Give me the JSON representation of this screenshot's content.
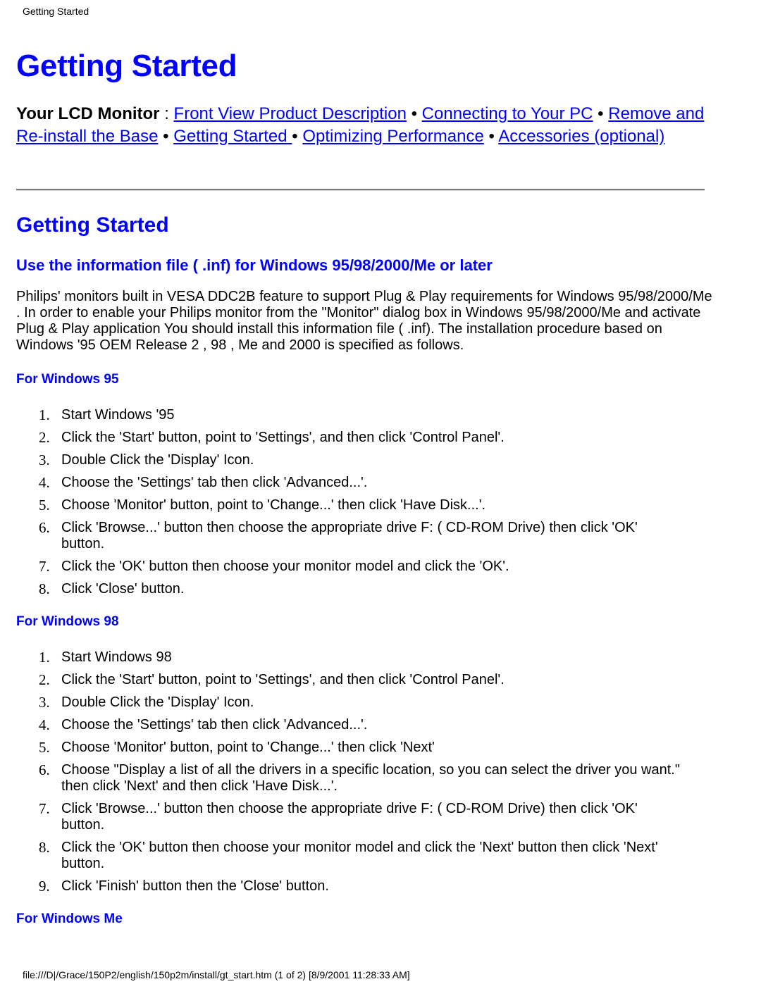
{
  "page_header": "Getting Started",
  "main_title": "Getting Started",
  "nav": {
    "label": "Your LCD Monitor",
    "separator_colon": " : ",
    "bullet": " • ",
    "links": [
      "Front View Product Description",
      "Connecting to Your PC",
      "Remove and Re-install the Base",
      "Getting Started ",
      "Optimizing Performance",
      "Accessories (optional)"
    ]
  },
  "section_title": "Getting Started",
  "sub_title": "Use the information file ( .inf) for Windows 95/98/2000/Me or later",
  "intro": "Philips' monitors built in VESA DDC2B feature to support Plug & Play requirements for Windows 95/98/2000/Me . In order to enable your Philips monitor from the \"Monitor\" dialog box in Windows 95/98/2000/Me and activate Plug & Play application You should install this information file ( .inf). The installation procedure based on Windows '95 OEM Release 2 , 98 , Me and 2000 is specified as follows.",
  "sections": [
    {
      "heading": "For Windows 95",
      "steps": [
        "Start Windows '95",
        "Click the 'Start' button, point to 'Settings', and then click 'Control Panel'.",
        "Double Click the 'Display' Icon.",
        "Choose the 'Settings' tab then click 'Advanced...'.",
        "Choose 'Monitor' button, point to 'Change...' then click 'Have Disk...'.",
        "Click 'Browse...' button then choose the appropriate drive F: ( CD-ROM Drive) then click 'OK' button.",
        "Click the 'OK' button then choose your monitor model and click the 'OK'.",
        "Click 'Close' button."
      ]
    },
    {
      "heading": "For Windows 98",
      "steps": [
        "Start Windows 98",
        "Click the 'Start' button, point to 'Settings', and then click 'Control Panel'.",
        "Double Click the 'Display' Icon.",
        "Choose the 'Settings' tab then click 'Advanced...'.",
        "Choose 'Monitor' button, point to 'Change...' then click 'Next'",
        "Choose \"Display a list of all the drivers in a specific location, so you can select the driver you want.\" then click 'Next' and then click 'Have Disk...'.",
        "Click 'Browse...' button then choose the appropriate drive F: ( CD-ROM Drive) then click 'OK' button.",
        "Click the 'OK' button then choose your monitor model and click the 'Next' button then click 'Next' button.",
        "Click 'Finish' button then the 'Close' button."
      ]
    },
    {
      "heading": "For Windows Me",
      "steps": []
    }
  ],
  "footer": "file:///D|/Grace/150P2/english/150p2m/install/gt_start.htm (1 of 2) [8/9/2001 11:28:33 AM]",
  "colors": {
    "link": "#0000ff",
    "heading": "#0000ff",
    "text": "#000000"
  }
}
